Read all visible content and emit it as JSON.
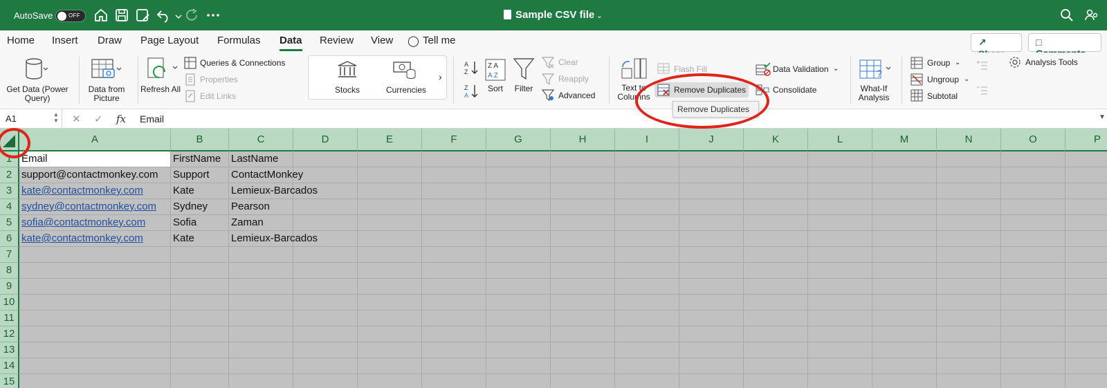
{
  "titlebar": {
    "autosave_label": "AutoSave",
    "toggle_state": "OFF",
    "document_title": "Sample CSV file"
  },
  "menu": {
    "tabs": [
      "Home",
      "Insert",
      "Draw",
      "Page Layout",
      "Formulas",
      "Data",
      "Review",
      "View",
      "Tell me"
    ],
    "active_tab": "Data",
    "share_label": "Share",
    "comments_label": "Comments"
  },
  "ribbon": {
    "get_data": "Get Data (Power Query)",
    "data_from_picture": "Data from Picture",
    "refresh_all": "Refresh All",
    "queries_connections": "Queries & Connections",
    "properties": "Properties",
    "edit_links": "Edit Links",
    "stocks": "Stocks",
    "currencies": "Currencies",
    "sort": "Sort",
    "filter": "Filter",
    "clear": "Clear",
    "reapply": "Reapply",
    "advanced": "Advanced",
    "text_to_columns": "Text to Columns",
    "flash_fill": "Flash Fill",
    "remove_duplicates": "Remove Duplicates",
    "data_validation": "Data Validation",
    "consolidate": "Consolidate",
    "what_if": "What-If Analysis",
    "group": "Group",
    "ungroup": "Ungroup",
    "subtotal": "Subtotal",
    "analysis_tools": "Analysis Tools",
    "tooltip": "Remove Duplicates"
  },
  "formula_bar": {
    "name_box": "A1",
    "fx": "fx",
    "content": "Email"
  },
  "sheet": {
    "columns": [
      "A",
      "B",
      "C",
      "D",
      "E",
      "F",
      "G",
      "H",
      "I",
      "J",
      "K",
      "L",
      "M",
      "N",
      "O",
      "P"
    ],
    "rows": [
      "1",
      "2",
      "3",
      "4",
      "5",
      "6",
      "7",
      "8",
      "9",
      "10",
      "11",
      "12",
      "13",
      "14",
      "15"
    ],
    "data": [
      [
        "Email",
        "FirstName",
        "LastName"
      ],
      [
        "support@contactmonkey.com",
        "Support",
        "ContactMonkey"
      ],
      [
        "kate@contactmonkey.com",
        "Kate",
        "Lemieux-Barcados"
      ],
      [
        "sydney@contactmonkey.com",
        "Sydney",
        "Pearson"
      ],
      [
        "sofia@contactmonkey.com",
        "Sofia",
        "Zaman"
      ],
      [
        "kate@contactmonkey.com",
        "Kate",
        "Lemieux-Barcados"
      ]
    ]
  },
  "colors": {
    "accent": "#1e7a40",
    "header_fill": "#b9d9c2",
    "selection_fill": "#c1c1c1",
    "annotation": "#e02418",
    "link": "#1f4f9e"
  }
}
